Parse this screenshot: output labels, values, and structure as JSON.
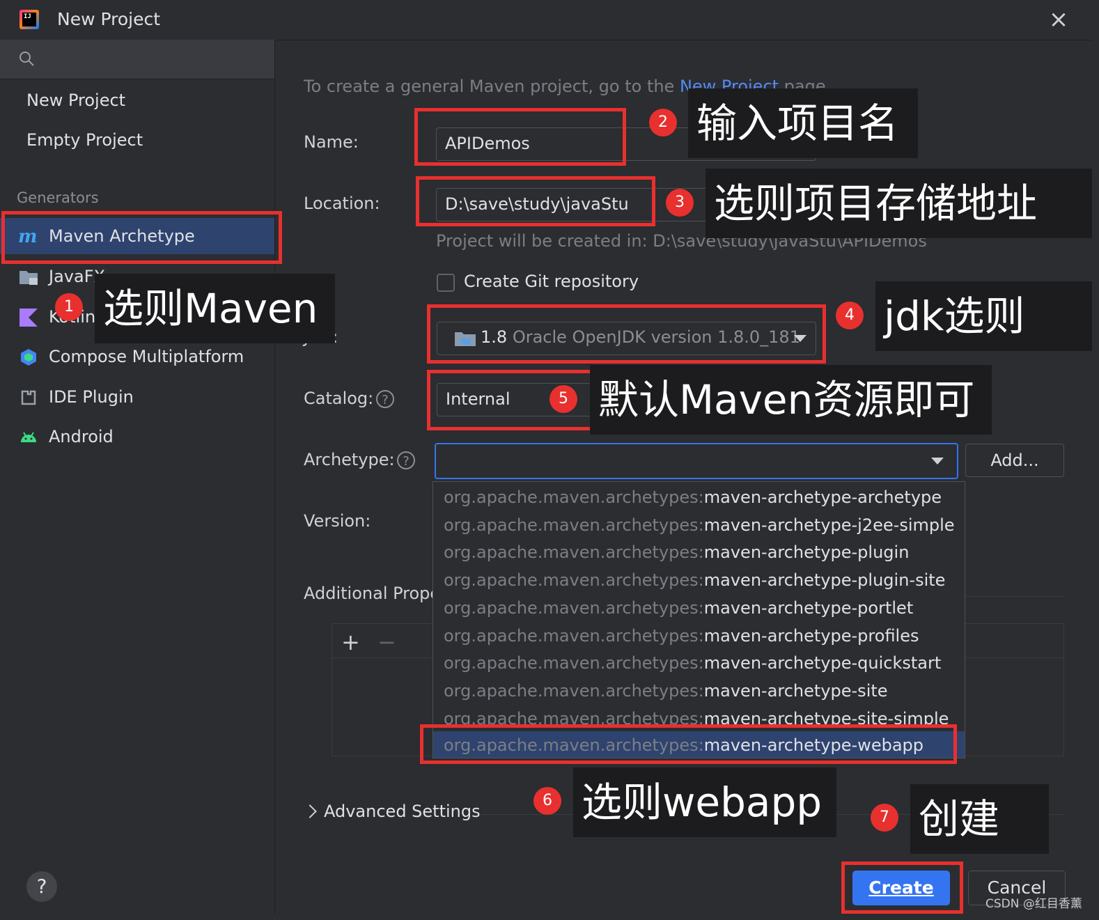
{
  "window": {
    "title": "New Project",
    "logo_text": "IJ"
  },
  "sidebar": {
    "search": {
      "placeholder": ""
    },
    "items": [
      {
        "label": "New Project"
      },
      {
        "label": "Empty Project"
      }
    ],
    "generators_label": "Generators",
    "generators": [
      {
        "label": "Maven Archetype",
        "icon": "maven-icon",
        "selected": true
      },
      {
        "label": "JavaFX",
        "icon": "folder-icon"
      },
      {
        "label": "Kotlin Multiplatform",
        "icon": "kotlin-icon"
      },
      {
        "label": "Compose Multiplatform",
        "icon": "compose-icon"
      },
      {
        "label": "IDE Plugin",
        "icon": "plugin-icon"
      },
      {
        "label": "Android",
        "icon": "android-icon"
      }
    ]
  },
  "main": {
    "intro_before": "To create a general Maven project, go to the ",
    "intro_link": "New Project",
    "intro_after": " page.",
    "name": {
      "label": "Name:",
      "value": "APIDemos"
    },
    "location": {
      "label": "Location:",
      "value": "D:\\save\\study\\javaStu",
      "hint": "Project will be created in: D:\\save\\study\\javaStu\\APIDemos"
    },
    "git": {
      "label": "Create Git repository",
      "checked": false
    },
    "jdk": {
      "label": "JDK:",
      "version": "1.8",
      "name": "Oracle OpenJDK version 1.8.0_181"
    },
    "catalog": {
      "label": "Catalog:",
      "value": "Internal",
      "help": "?"
    },
    "archetype": {
      "label": "Archetype:",
      "value": "",
      "help": "?",
      "add_label": "Add..."
    },
    "version": {
      "label": "Version:"
    },
    "additional_properties": {
      "label": "Additional Properties",
      "add": "+",
      "remove": "−"
    },
    "archetype_options": [
      {
        "group": "org.apache.maven.archetypes:",
        "artifact": "maven-archetype-archetype"
      },
      {
        "group": "org.apache.maven.archetypes:",
        "artifact": "maven-archetype-j2ee-simple"
      },
      {
        "group": "org.apache.maven.archetypes:",
        "artifact": "maven-archetype-plugin"
      },
      {
        "group": "org.apache.maven.archetypes:",
        "artifact": "maven-archetype-plugin-site"
      },
      {
        "group": "org.apache.maven.archetypes:",
        "artifact": "maven-archetype-portlet"
      },
      {
        "group": "org.apache.maven.archetypes:",
        "artifact": "maven-archetype-profiles"
      },
      {
        "group": "org.apache.maven.archetypes:",
        "artifact": "maven-archetype-quickstart"
      },
      {
        "group": "org.apache.maven.archetypes:",
        "artifact": "maven-archetype-site"
      },
      {
        "group": "org.apache.maven.archetypes:",
        "artifact": "maven-archetype-site-simple"
      },
      {
        "group": "org.apache.maven.archetypes:",
        "artifact": "maven-archetype-webapp",
        "selected": true
      }
    ],
    "advanced_settings": "Advanced Settings"
  },
  "footer": {
    "help": "?",
    "create": "Create",
    "cancel": "Cancel"
  },
  "annotations": {
    "colors": {
      "red": "#e8302f",
      "callout_bg": "#1c1c1e"
    },
    "steps": [
      {
        "num": "1",
        "text": "选则Maven"
      },
      {
        "num": "2",
        "text": "输入项目名"
      },
      {
        "num": "3",
        "text": "选则项目存储地址"
      },
      {
        "num": "4",
        "text": "jdk选则"
      },
      {
        "num": "5",
        "text": "默认Maven资源即可"
      },
      {
        "num": "6",
        "text": "选则webapp"
      },
      {
        "num": "7",
        "text": "创建"
      }
    ]
  },
  "watermark": "CSDN @红目香薰"
}
